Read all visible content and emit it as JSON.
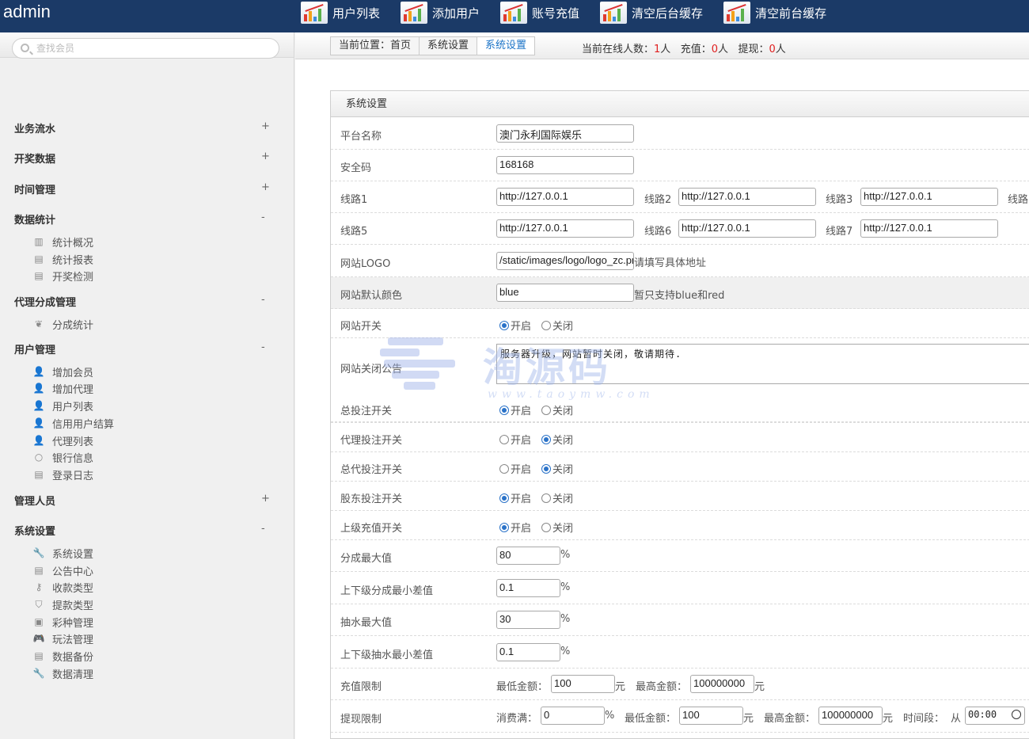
{
  "brand": "admin",
  "topnav": [
    "用户列表",
    "添加用户",
    "账号充值",
    "清空后台缓存",
    "清空前台缓存"
  ],
  "sidebar": {
    "search_placeholder": "查找会员",
    "sections": [
      {
        "title": "业务流水",
        "sign": "+"
      },
      {
        "title": "开奖数据",
        "sign": "+"
      },
      {
        "title": "时间管理",
        "sign": "+"
      },
      {
        "title": "数据统计",
        "sign": "-",
        "items": [
          {
            "label": "统计概况",
            "icon": "chart-icon"
          },
          {
            "label": "统计报表",
            "icon": "report-icon"
          },
          {
            "label": "开奖检测",
            "icon": "check-icon"
          }
        ]
      },
      {
        "title": "代理分成管理",
        "sign": "-",
        "items": [
          {
            "label": "分成统计",
            "icon": "share-icon"
          }
        ]
      },
      {
        "title": "用户管理",
        "sign": "-",
        "items": [
          {
            "label": "增加会员",
            "icon": "user-add-icon"
          },
          {
            "label": "增加代理",
            "icon": "agent-add-icon"
          },
          {
            "label": "用户列表",
            "icon": "user-icon"
          },
          {
            "label": "信用用户结算",
            "icon": "user-icon"
          },
          {
            "label": "代理列表",
            "icon": "user-icon"
          },
          {
            "label": "银行信息",
            "icon": "bank-icon"
          },
          {
            "label": "登录日志",
            "icon": "log-icon"
          }
        ]
      },
      {
        "title": "管理人员",
        "sign": "+"
      },
      {
        "title": "系统设置",
        "sign": "-",
        "items": [
          {
            "label": "系统设置",
            "icon": "wrench-icon"
          },
          {
            "label": "公告中心",
            "icon": "notice-icon"
          },
          {
            "label": "收款类型",
            "icon": "key-icon"
          },
          {
            "label": "提款类型",
            "icon": "withdraw-icon"
          },
          {
            "label": "彩种管理",
            "icon": "lottery-icon"
          },
          {
            "label": "玩法管理",
            "icon": "gamepad-icon"
          },
          {
            "label": "数据备份",
            "icon": "backup-icon"
          },
          {
            "label": "数据清理",
            "icon": "wrench-icon"
          }
        ]
      }
    ]
  },
  "breadcrumb": {
    "prefix": "当前位置：",
    "home": "首页",
    "parent": "系统设置",
    "current": "系统设置"
  },
  "online": {
    "label": "当前在线人数：",
    "count": "1",
    "unit": "人",
    "recharge_label": "充值：",
    "recharge": "0",
    "withdraw_label": "提现：",
    "withdraw": "0"
  },
  "panel_title": "系统设置",
  "form": {
    "platform_name": {
      "label": "平台名称",
      "value": "澳门永利国际娱乐"
    },
    "security_code": {
      "label": "安全码",
      "value": "168168"
    },
    "lines_a": {
      "label": "线路1",
      "l2": "线路2",
      "l3": "线路3",
      "l4": "线路",
      "v1": "http://127.0.0.1",
      "v2": "http://127.0.0.1",
      "v3": "http://127.0.0.1"
    },
    "lines_b": {
      "label": "线路5",
      "l6": "线路6",
      "l7": "线路7",
      "v5": "http://127.0.0.1",
      "v6": "http://127.0.0.1",
      "v7": "http://127.0.0.1"
    },
    "logo": {
      "label": "网站LOGO",
      "value": "/static/images/logo/logo_zc.png",
      "hint": "请填写具体地址"
    },
    "color": {
      "label": "网站默认颜色",
      "value": "blue",
      "hint": "暂只支持blue和red"
    },
    "site_switch": {
      "label": "网站开关",
      "on": "开启",
      "off": "关闭",
      "selected": "on"
    },
    "close_notice": {
      "label": "网站关闭公告",
      "value": "服务器升级，网站暂时关闭，敬请期待."
    },
    "bet_switch": {
      "label": "总投注开关",
      "on": "开启",
      "off": "关闭",
      "selected": "on"
    },
    "agent_bet": {
      "label": "代理投注开关",
      "on": "开启",
      "off": "关闭",
      "selected": "off"
    },
    "general_agent_bet": {
      "label": "总代投注开关",
      "on": "开启",
      "off": "关闭",
      "selected": "off"
    },
    "shareholder_bet": {
      "label": "股东投注开关",
      "on": "开启",
      "off": "关闭",
      "selected": "on"
    },
    "parent_recharge": {
      "label": "上级充值开关",
      "on": "开启",
      "off": "关闭",
      "selected": "on"
    },
    "max_share": {
      "label": "分成最大值",
      "value": "80",
      "unit": "%"
    },
    "min_share_diff": {
      "label": "上下级分成最小差值",
      "value": "0.1",
      "unit": "%"
    },
    "max_rebate": {
      "label": "抽水最大值",
      "value": "30",
      "unit": "%"
    },
    "min_rebate_diff": {
      "label": "上下级抽水最小差值",
      "value": "0.1",
      "unit": "%"
    },
    "recharge_limit": {
      "label": "充值限制",
      "min_label": "最低金额：",
      "min": "100",
      "unit": "元",
      "max_label": "最高金额：",
      "max": "100000000"
    },
    "withdraw_limit": {
      "label": "提现限制",
      "consume_label": "消费满：",
      "consume": "0",
      "pct": "%",
      "min_label": "最低金额：",
      "min": "100",
      "unit": "元",
      "max_label": "最高金额：",
      "max": "100000000",
      "period_label": "时间段：",
      "from": "从",
      "time": "00:00"
    }
  },
  "watermark": {
    "cn": "淘源码",
    "en": "www.taoymw.com"
  }
}
